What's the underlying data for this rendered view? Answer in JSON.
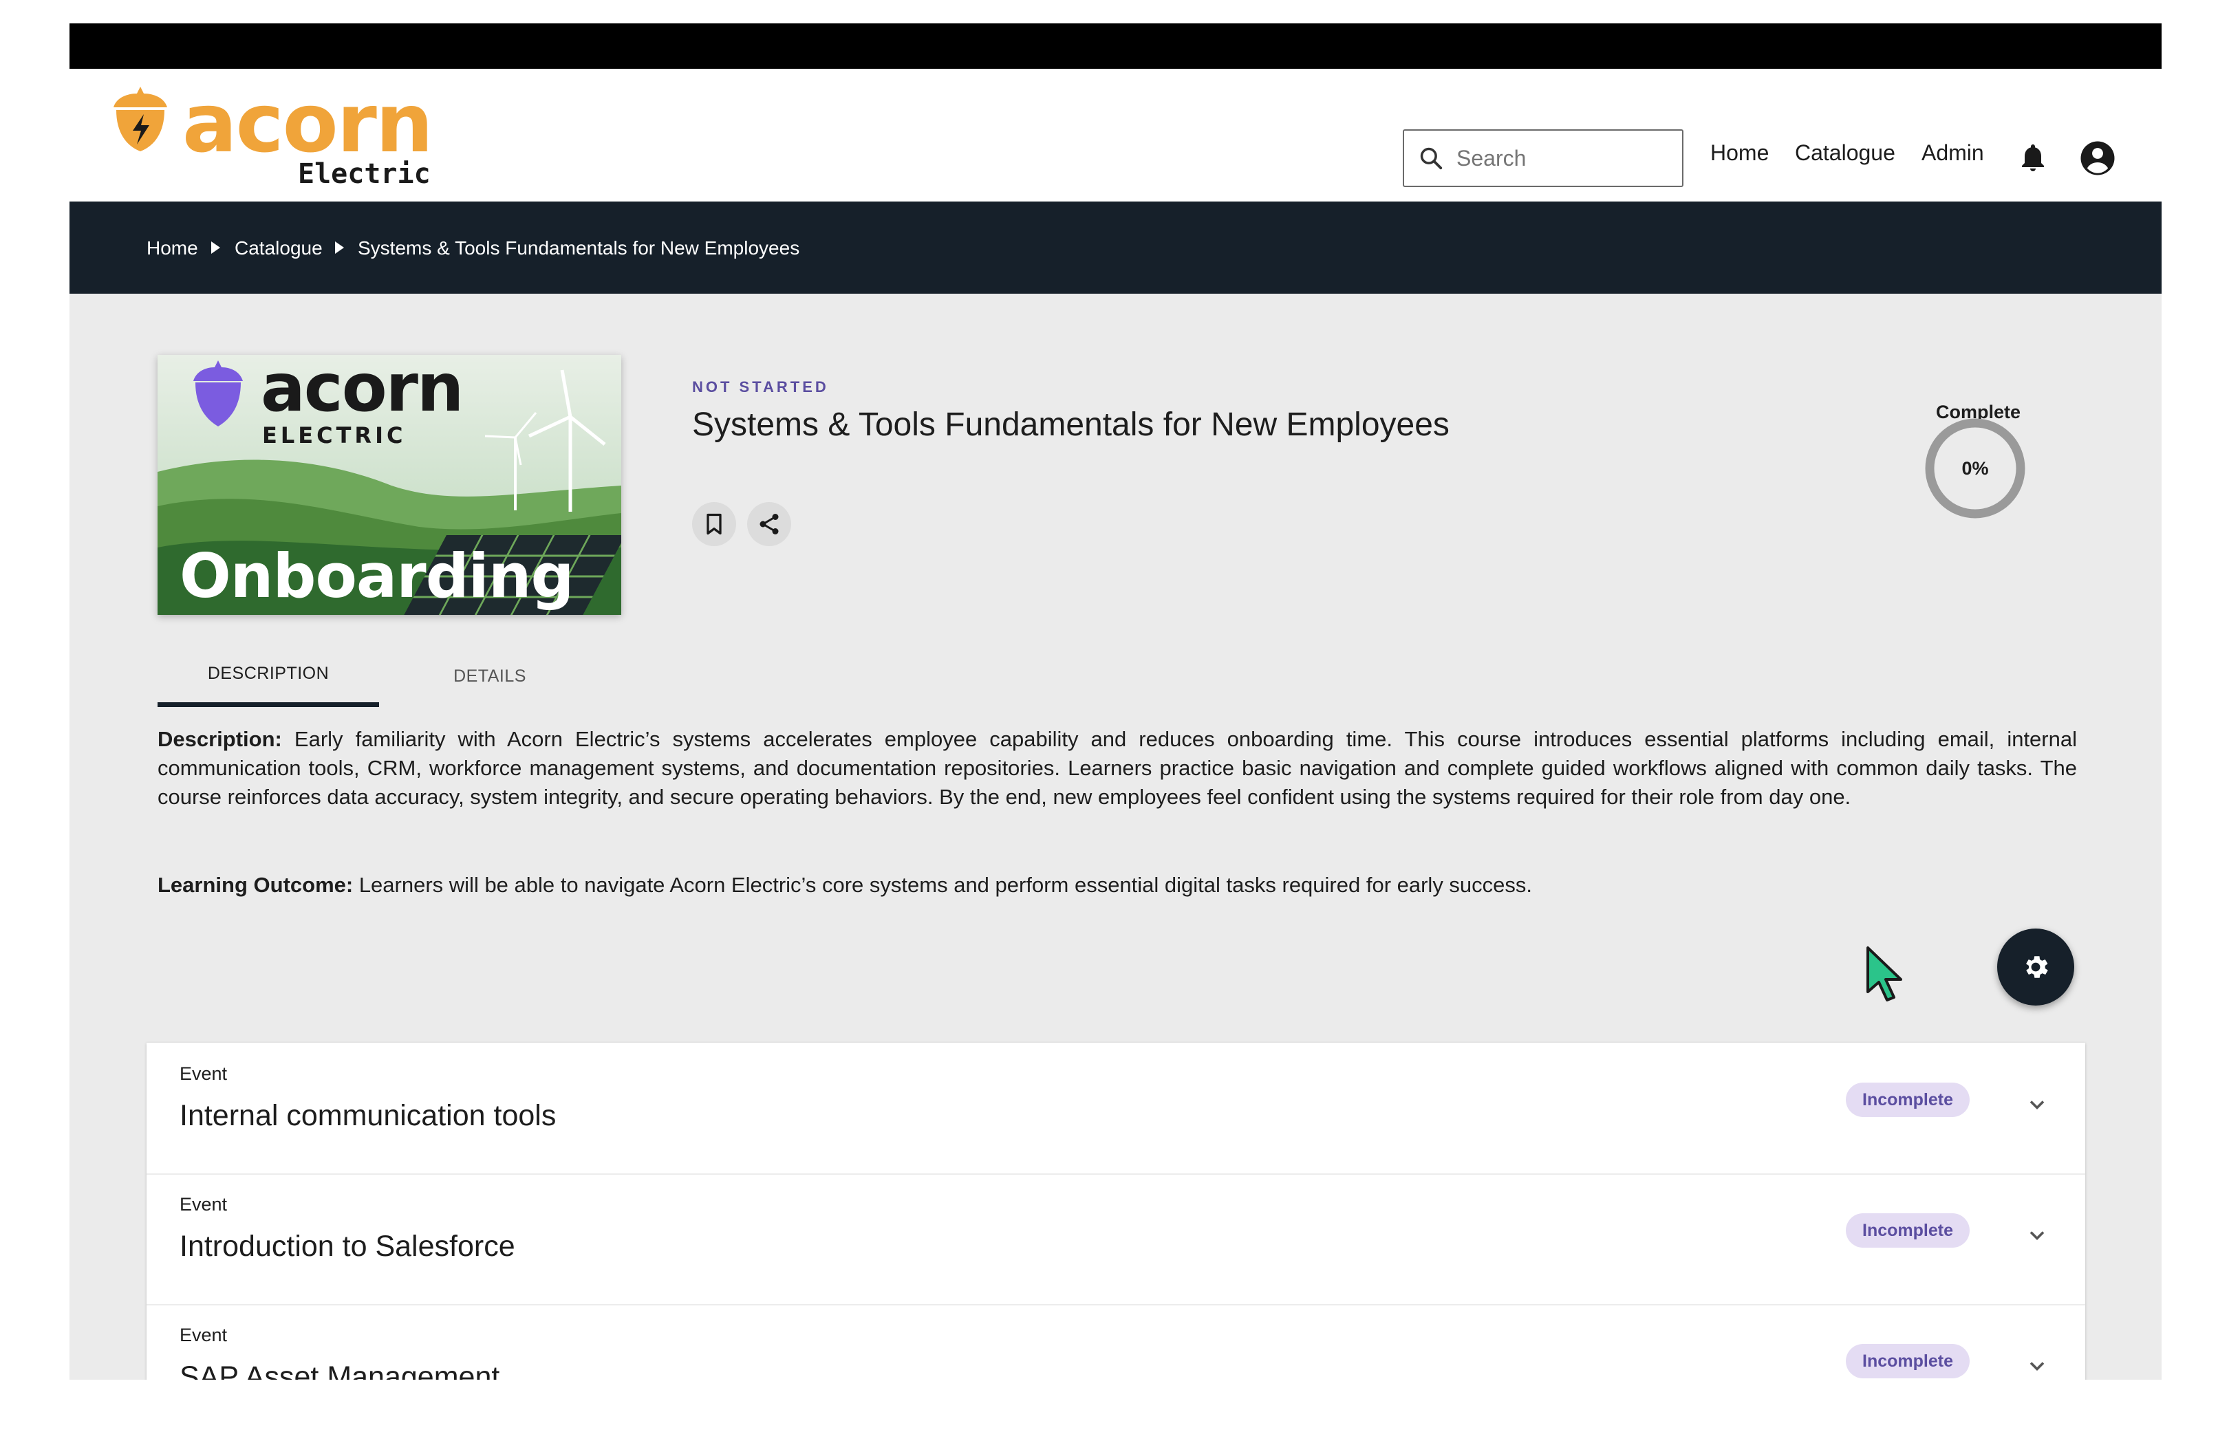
{
  "header": {
    "logo_word": "acorn",
    "logo_sub": "Electric",
    "search_placeholder": "Search",
    "nav": [
      "Home",
      "Catalogue",
      "Admin"
    ]
  },
  "breadcrumb": [
    "Home",
    "Catalogue",
    "Systems & Tools Fundamentals for New Employees"
  ],
  "course": {
    "thumbnail": {
      "word": "acorn",
      "sub": "ELECTRIC",
      "title": "Onboarding"
    },
    "status": "NOT STARTED",
    "title": "Systems & Tools Fundamentals for New Employees",
    "complete_label": "Complete",
    "progress_text": "0%",
    "progress_fraction": 0
  },
  "tabs": [
    "DESCRIPTION",
    "DETAILS"
  ],
  "description": {
    "label": "Description:",
    "text": " Early familiarity with Acorn Electric’s systems accelerates employee capability and reduces onboarding time. This course introduces essential platforms including email, internal communication tools, CRM, workforce management systems, and documentation repositories. Learners practice basic navigation and complete guided workflows aligned with common daily tasks. The course reinforces data accuracy, system integrity, and secure operating behaviors. By the end, new employees feel confident using the systems required for their role from day one.",
    "outcome_label": "Learning Outcome:",
    "outcome_text": " Learners will be able to navigate Acorn Electric’s core systems and perform essential digital tasks required for early success."
  },
  "events": [
    {
      "type": "Event",
      "title": "Internal communication tools",
      "status": "Incomplete"
    },
    {
      "type": "Event",
      "title": "Introduction to Salesforce",
      "status": "Incomplete"
    },
    {
      "type": "Event",
      "title": "SAP Asset Management",
      "status": "Incomplete"
    }
  ],
  "colors": {
    "brand_orange": "#f0a43a",
    "navy": "#16202a",
    "purple": "#5b4ea0",
    "badge_bg": "#e4dcf3"
  }
}
